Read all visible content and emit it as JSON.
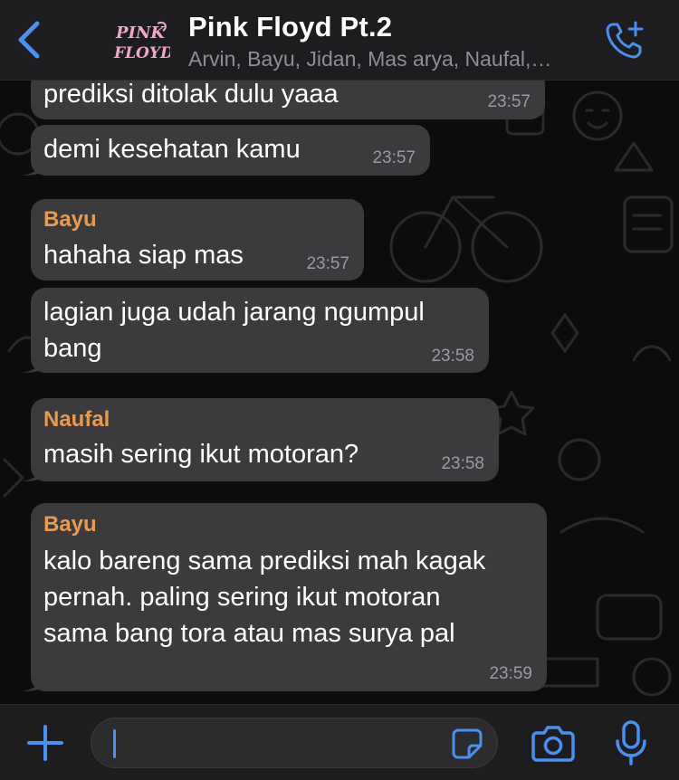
{
  "header": {
    "title": "Pink Floyd Pt.2",
    "subtitle": "Arvin, Bayu, Jidan, Mas arya, Naufal,…",
    "avatar_text": "PINK FLOYD"
  },
  "messages": [
    {
      "sender": "",
      "text": "prediksi ditolak dulu yaaa",
      "time": "23:57"
    },
    {
      "sender": "",
      "text": "demi kesehatan kamu",
      "time": "23:57"
    },
    {
      "sender": "Bayu",
      "text": "hahaha siap mas",
      "time": "23:57"
    },
    {
      "sender": "",
      "text": "lagian juga udah jarang ngumpul\nbang",
      "time": "23:58"
    },
    {
      "sender": "Naufal",
      "text": "masih sering ikut motoran?",
      "time": "23:58"
    },
    {
      "sender": "Bayu",
      "text": "kalo bareng sama prediksi mah kagak\npernah. paling sering ikut motoran\nsama bang tora atau mas surya pal",
      "time": "23:59"
    }
  ],
  "composer": {
    "placeholder": ""
  },
  "icons": {
    "back": "chevron-left-icon",
    "call": "phone-plus-icon",
    "plus": "plus-icon",
    "sticker": "sticker-icon",
    "camera": "camera-icon",
    "mic": "microphone-icon"
  },
  "colors": {
    "accent": "#4a90f0",
    "bubble": "#3b3b3d",
    "sender_name": "#e69a52",
    "avatar_pink": "#f2a6c6"
  }
}
